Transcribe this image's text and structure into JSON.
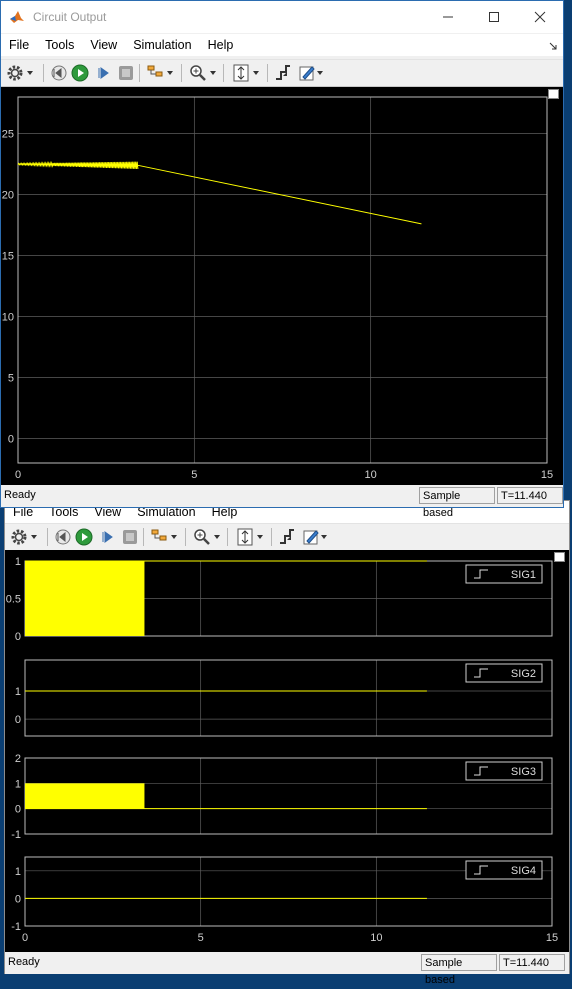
{
  "window": {
    "title": "Circuit Output",
    "menu": [
      "File",
      "Tools",
      "View",
      "Simulation",
      "Help"
    ],
    "status": {
      "ready": "Ready",
      "mode": "Sample based",
      "time": "T=11.440"
    }
  },
  "window2": {
    "menu": [
      "File",
      "Tools",
      "View",
      "Simulation",
      "Help"
    ],
    "status": {
      "ready": "Ready",
      "mode": "Sample based",
      "time": "T=11.440"
    }
  },
  "toolbar_icons": [
    "gear-icon",
    "step-back-icon",
    "run-icon",
    "step-forward-icon",
    "stop-icon",
    "highlight-icon",
    "zoom-in-icon",
    "autoscale-icon",
    "trigger-icon",
    "edit-icon"
  ],
  "colors": {
    "trace": "#ffff00",
    "axes_bg": "#000000",
    "grid": "#5e5e5e",
    "tick_text": "#cfcfcf"
  },
  "chart_data": [
    {
      "type": "line",
      "xlim": [
        0,
        15
      ],
      "ylim": [
        -2,
        28
      ],
      "xticks": [
        0,
        5,
        10,
        15
      ],
      "yticks": [
        0,
        5,
        10,
        15,
        20,
        25
      ],
      "grid": true,
      "series": [
        {
          "x": [
            0,
            3.4,
            11.44
          ],
          "y": [
            22.5,
            22.4,
            17.6
          ],
          "noisy_until_x": 3.4
        }
      ]
    },
    {
      "type": "line",
      "xlim": [
        0,
        15
      ],
      "ylim": [
        0,
        1
      ],
      "yticks": [
        0,
        0.5,
        1
      ],
      "grid": true,
      "legend": [
        "SIG1"
      ],
      "legend_placement": "top-right",
      "series": [
        {
          "name": "SIG1",
          "x": [
            0,
            11.44
          ],
          "y": [
            1,
            1
          ],
          "filled_until_x": 3.4,
          "fill_range": [
            0,
            1
          ]
        }
      ]
    },
    {
      "type": "line",
      "xlim": [
        0,
        15
      ],
      "ylim": [
        -0.6,
        2.1
      ],
      "yticks": [
        0,
        1
      ],
      "grid": true,
      "legend": [
        "SIG2"
      ],
      "legend_placement": "top-right",
      "series": [
        {
          "name": "SIG2",
          "x": [
            0,
            11.44
          ],
          "y": [
            1,
            1
          ]
        }
      ]
    },
    {
      "type": "line",
      "xlim": [
        0,
        15
      ],
      "ylim": [
        -1,
        2
      ],
      "yticks": [
        -1,
        0,
        1,
        2
      ],
      "grid": true,
      "legend": [
        "SIG3"
      ],
      "legend_placement": "top-right",
      "series": [
        {
          "name": "SIG3",
          "x": [
            0,
            11.44
          ],
          "y": [
            0,
            0
          ],
          "filled_until_x": 3.4,
          "fill_range": [
            0,
            1
          ]
        }
      ]
    },
    {
      "type": "line",
      "xlim": [
        0,
        15
      ],
      "ylim": [
        -1,
        1.5
      ],
      "yticks": [
        -1,
        0,
        1
      ],
      "xticks": [
        0,
        5,
        10,
        15
      ],
      "grid": true,
      "legend": [
        "SIG4"
      ],
      "legend_placement": "top-right",
      "series": [
        {
          "name": "SIG4",
          "x": [
            0,
            11.44
          ],
          "y": [
            0,
            0
          ]
        }
      ]
    }
  ]
}
